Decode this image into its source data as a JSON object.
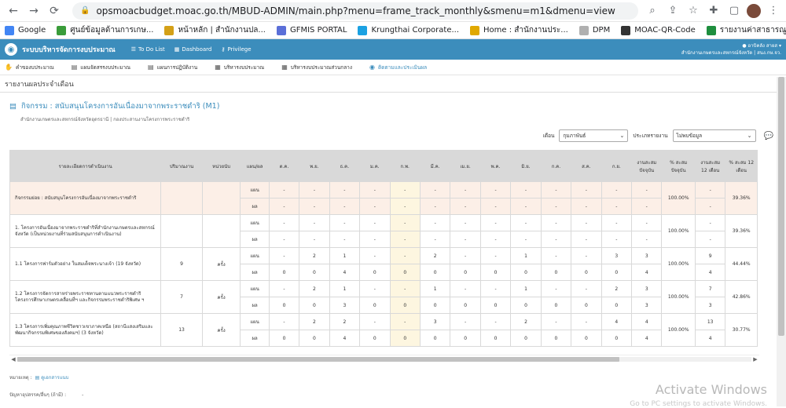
{
  "browser": {
    "url": "opsmoacbudget.moac.go.th/MBUD-ADMIN/main.php?menu=frame_track_monthly&smenu=m1&dmenu=view",
    "bookmarks": [
      {
        "label": "Google",
        "color": "#4285f4"
      },
      {
        "label": "ศูนย์ข้อมูลด้านการเกษ...",
        "color": "#3a9c3a"
      },
      {
        "label": "หน้าหลัก | สำนักงานปล...",
        "color": "#d4a017"
      },
      {
        "label": "GFMIS PORTAL",
        "color": "#5b6fd8"
      },
      {
        "label": "Krungthai Corporate...",
        "color": "#1ba1e2"
      },
      {
        "label": "Home : สำนักงานประ...",
        "color": "#e0a800"
      },
      {
        "label": "DPM",
        "color": "#b0b0b0"
      },
      {
        "label": "MOAC-QR-Code",
        "color": "#333333"
      },
      {
        "label": "รายงานค่าสาธารณูปโภ...",
        "color": "#1e8e3e"
      },
      {
        "label": "กรมบัญชีกลาง",
        "color": "#8a8a8a"
      }
    ]
  },
  "header": {
    "app_title": "ระบบบริหารจัดการงบประมาณ",
    "links": [
      "To Do List",
      "Dashboard",
      "Privilege"
    ],
    "user_name": "อาบิคลัง สายส",
    "user_org": "สำนักงานเกษตรและสหกรณ์จังหวัด | สนง.กษ.จว."
  },
  "menu": [
    {
      "label": "คำของบประมาณ",
      "icon": "hand-icon",
      "active": false
    },
    {
      "label": "แผนจัดสรรงบประมาณ",
      "icon": "list-icon",
      "active": false
    },
    {
      "label": "แผนการปฏิบัติงาน",
      "icon": "list-icon",
      "active": false
    },
    {
      "label": "บริหารงบประมาณ",
      "icon": "doc-icon",
      "active": false
    },
    {
      "label": "บริหารงบประมาณส่วนกลาง",
      "icon": "doc-icon",
      "active": false
    },
    {
      "label": "ติดตามและประเมินผล",
      "icon": "chart-icon",
      "active": true
    }
  ],
  "page_title": "รายงานผลประจำเดือน",
  "activity": {
    "title": "กิจกรรม : สนับสนุนโครงการอันเนื่องมาจากพระราชดำริ (M1)",
    "subtitle": "สำนักงานเกษตรและสหกรณ์จังหวัดอุดรธานี | กองประสานงานโครงการพระราชดำริ"
  },
  "filters": {
    "month_label": "เดือน",
    "month_value": "กุมภาพันธ์",
    "type_label": "ประเภทรายงาน",
    "type_value": "ไม่พบข้อมูล"
  },
  "table": {
    "headers": [
      "รายละเอียดการดำเนินงาน",
      "ปริมาณงาน",
      "หน่วยนับ",
      "แผน/ผล",
      "ต.ค.",
      "พ.ย.",
      "ธ.ค.",
      "ม.ค.",
      "ก.พ.",
      "มี.ค.",
      "เม.ย.",
      "พ.ค.",
      "มิ.ย.",
      "ก.ค.",
      "ส.ค.",
      "ก.ย.",
      "งานสะสมปัจจุบัน",
      "% สะสมปัจจุบัน",
      "งานสะสม 12 เดือน",
      "% สะสม 12 เดือน"
    ],
    "groups": [
      {
        "name": "กิจกรรมย่อย : สนับสนุนโครงการอันเนื่องมาจากพระราชดำริ",
        "qty": "",
        "unit": "",
        "summary": true,
        "plan": [
          "แผน",
          "-",
          "-",
          "-",
          "-",
          "-",
          "-",
          "-",
          "-",
          "-",
          "-",
          "-",
          "-",
          "-",
          "-"
        ],
        "result": [
          "ผล",
          "-",
          "-",
          "-",
          "-",
          "-",
          "-",
          "-",
          "-",
          "-",
          "-",
          "-",
          "-",
          "-",
          "-"
        ],
        "pct_now": "100.00%",
        "pct_12": "39.36%"
      },
      {
        "name": "1. โครงการอันเนื่องมาจากพระราชดำริที่สำนักงานเกษตรและสหกรณ์จังหวัด (เป็นหน่วยงานที่ร่วมสนับสนุนการดำเนินงาน)",
        "qty": "",
        "unit": "",
        "summary": false,
        "plan": [
          "แผน",
          "-",
          "-",
          "-",
          "-",
          "-",
          "-",
          "-",
          "-",
          "-",
          "-",
          "-",
          "-",
          "-",
          "-"
        ],
        "result": [
          "ผล",
          "-",
          "-",
          "-",
          "-",
          "-",
          "-",
          "-",
          "-",
          "-",
          "-",
          "-",
          "-",
          "-",
          "-"
        ],
        "pct_now": "100.00%",
        "pct_12": "39.36%"
      },
      {
        "name": "1.1 โครงการฟาร์มตัวอย่าง ในสมเด็จพระนางเจ้า (19 จังหวัด)",
        "qty": "9",
        "unit": "ครั้ง",
        "summary": false,
        "plan": [
          "แผน",
          "-",
          "2",
          "1",
          "-",
          "-",
          "2",
          "-",
          "-",
          "1",
          "-",
          "-",
          "3",
          "3",
          "9"
        ],
        "result": [
          "ผล",
          "0",
          "0",
          "4",
          "0",
          "0",
          "0",
          "0",
          "0",
          "0",
          "0",
          "0",
          "0",
          "4",
          "4"
        ],
        "pct_now": "100.00%",
        "pct_12": "44.44%"
      },
      {
        "name": "1.2 โครงการจัดการสาหร่ายพระราชทานตามแนวพระราชดำริ โครงการศึกษาเกษตรเคลื่อนที่ฯ และกิจกรรมพระราชดำริพิเศษ ฯ",
        "qty": "7",
        "unit": "ครั้ง",
        "summary": false,
        "plan": [
          "แผน",
          "-",
          "2",
          "1",
          "-",
          "-",
          "1",
          "-",
          "-",
          "1",
          "-",
          "-",
          "2",
          "3",
          "7"
        ],
        "result": [
          "ผล",
          "0",
          "0",
          "3",
          "0",
          "0",
          "0",
          "0",
          "0",
          "0",
          "0",
          "0",
          "0",
          "3",
          "3"
        ],
        "pct_now": "100.00%",
        "pct_12": "42.86%"
      },
      {
        "name": "1.3 โครงการเพิ่มคุณภาพชีวิตชาวเขาภาคเหนือ (สถานีแสงเสริมและพัฒนากิจกรรมพิเศษของสังคมฯ) (3 จังหวัด)",
        "qty": "13",
        "unit": "ครั้ง",
        "summary": false,
        "plan": [
          "แผน",
          "-",
          "2",
          "2",
          "-",
          "-",
          "3",
          "-",
          "-",
          "2",
          "-",
          "-",
          "4",
          "4",
          "13"
        ],
        "result": [
          "ผล",
          "0",
          "0",
          "4",
          "0",
          "0",
          "0",
          "0",
          "0",
          "0",
          "0",
          "0",
          "0",
          "4",
          "4"
        ],
        "pct_now": "100.00%",
        "pct_12": "30.77%"
      }
    ]
  },
  "footer": {
    "note_label": "หมายเหตุ :",
    "note_link": "ดูเอกสารแนบ",
    "problem_label": "ปัญหาอุปสรรค/อื่นๆ (ถ้ามี) :",
    "problem_value": "-"
  },
  "watermark": {
    "title": "Activate Windows",
    "subtitle": "Go to PC settings to activate Windows."
  }
}
